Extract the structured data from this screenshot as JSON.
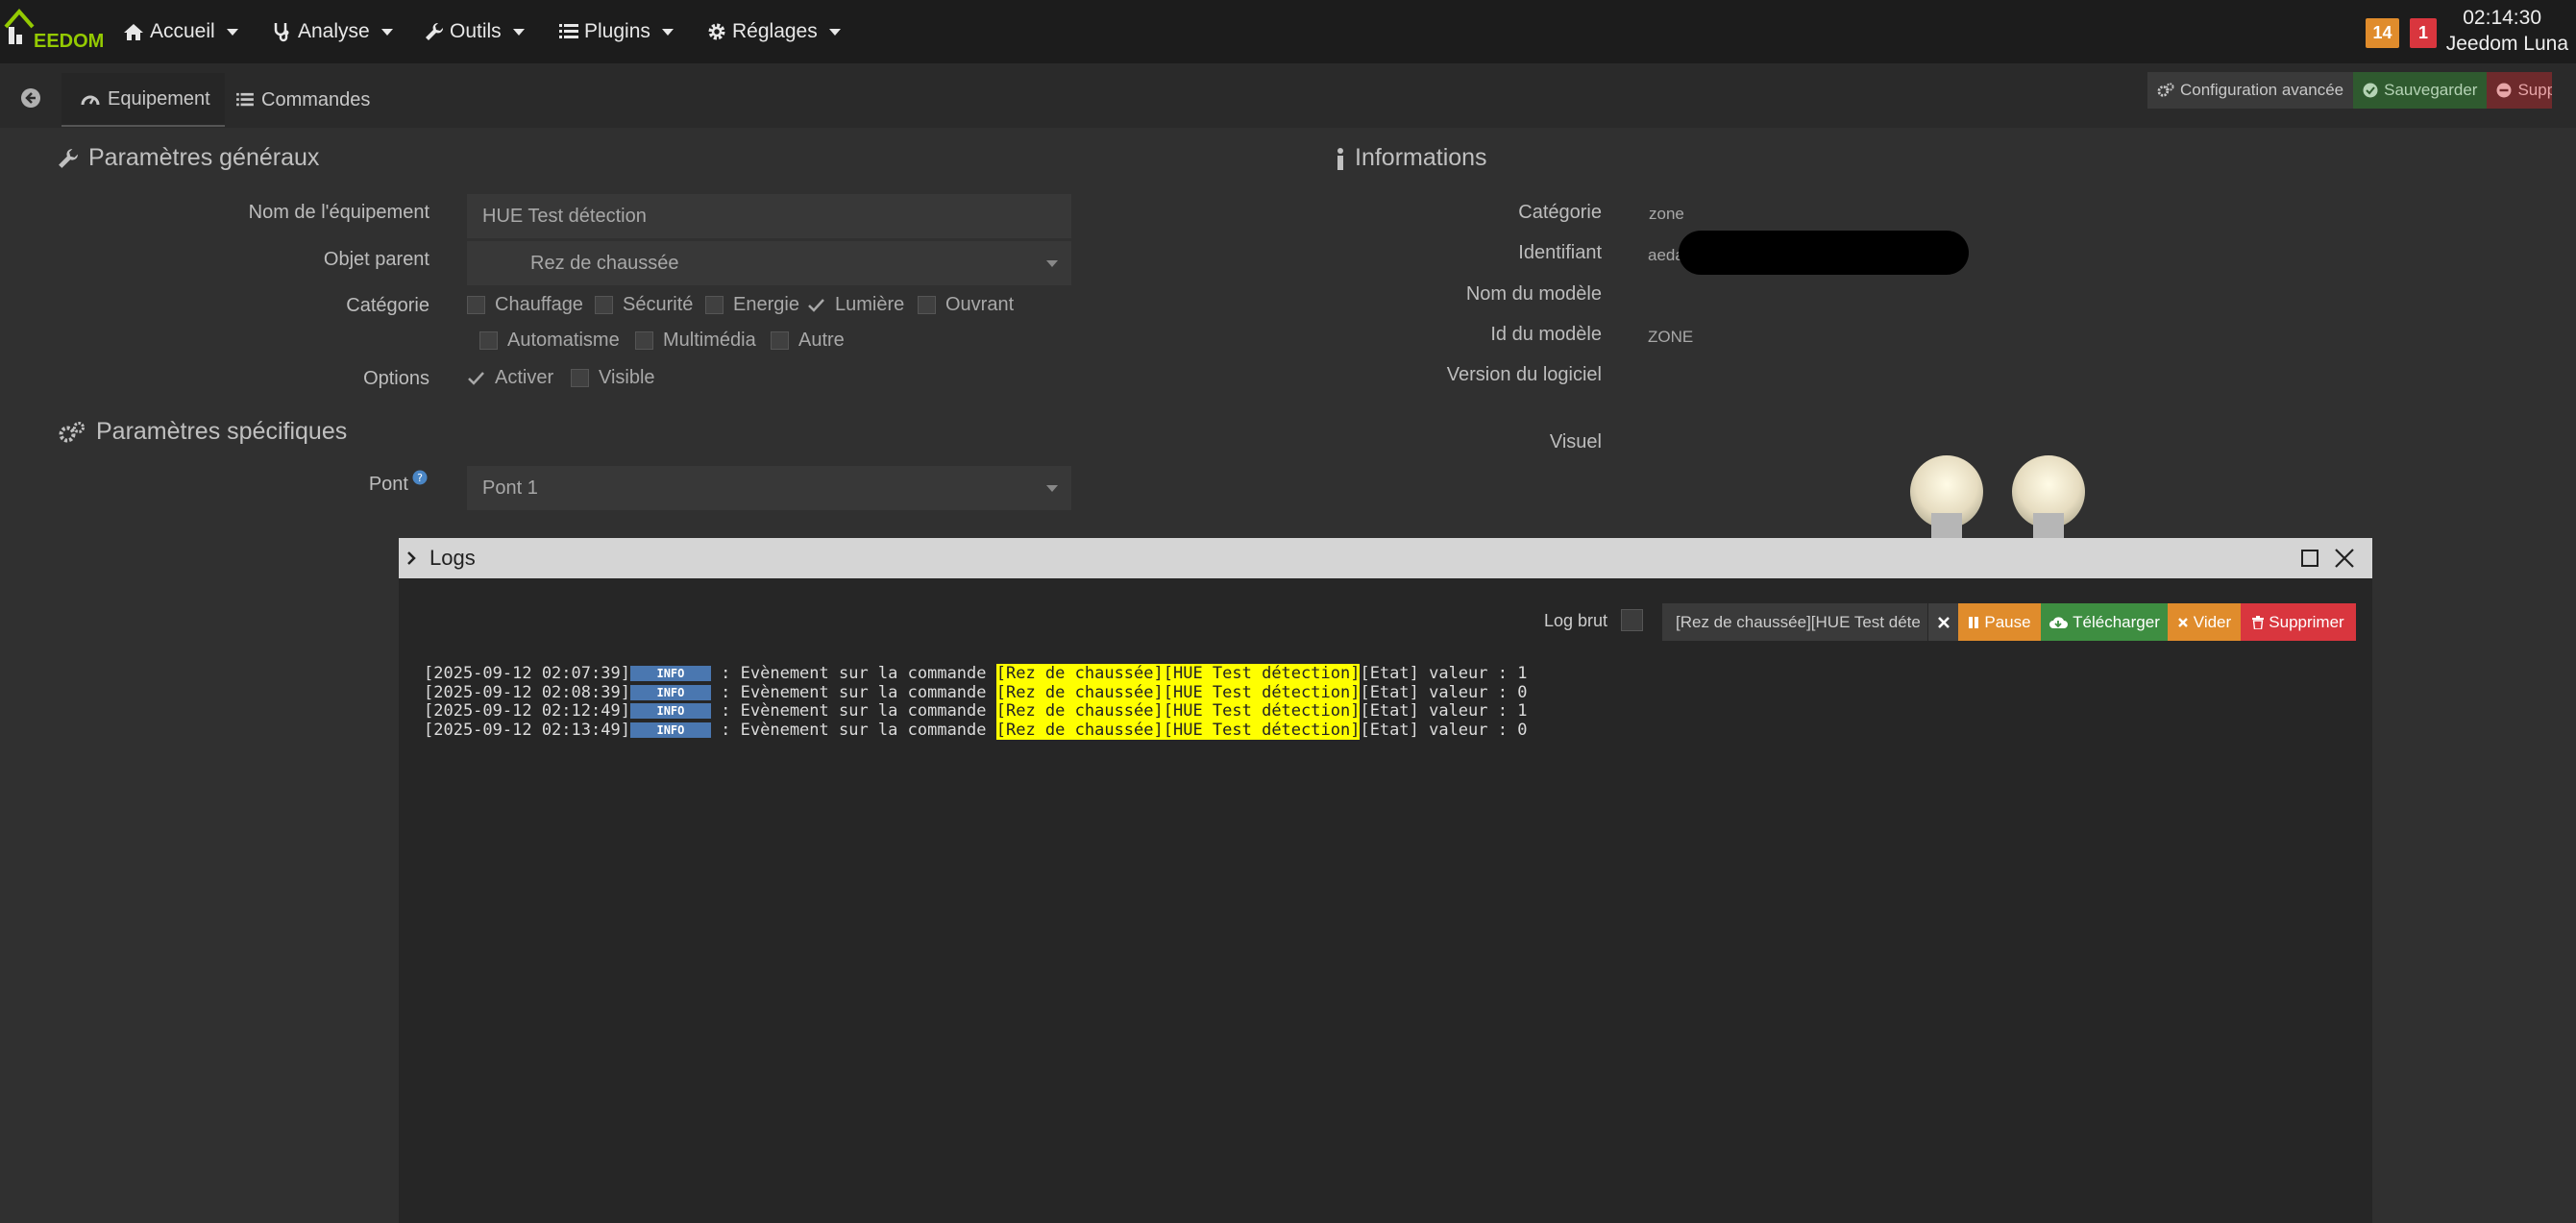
{
  "app": {
    "brand": "EEDOM"
  },
  "nav": [
    {
      "label": "Accueil",
      "icon": "home-icon"
    },
    {
      "label": "Analyse",
      "icon": "stethoscope-icon"
    },
    {
      "label": "Outils",
      "icon": "wrench-icon"
    },
    {
      "label": "Plugins",
      "icon": "list-icon"
    },
    {
      "label": "Réglages",
      "icon": "gear-icon"
    }
  ],
  "header": {
    "badge_warning": "14",
    "badge_danger": "1",
    "time": "02:14:30",
    "user": "Jeedom Luna",
    "colors": {
      "warning": "#e08c2c",
      "danger": "#d9363e",
      "brand": "#94ca02"
    }
  },
  "tabs": [
    {
      "label": "Equipement",
      "icon": "tachometer-icon",
      "active": true
    },
    {
      "label": "Commandes",
      "icon": "list-icon",
      "active": false
    }
  ],
  "actions": {
    "advanced": "Configuration avancée",
    "save": "Sauvegarder",
    "delete": "Supprimer"
  },
  "general": {
    "title": "Paramètres généraux",
    "name_label": "Nom de l'équipement",
    "name_value": "HUE Test détection",
    "parent_label": "Objet parent",
    "parent_value": "Rez de chaussée",
    "category_label": "Catégorie",
    "categories": [
      {
        "label": "Chauffage",
        "checked": false
      },
      {
        "label": "Sécurité",
        "checked": false
      },
      {
        "label": "Energie",
        "checked": false
      },
      {
        "label": "Lumière",
        "checked": true
      },
      {
        "label": "Ouvrant",
        "checked": false
      },
      {
        "label": "Automatisme",
        "checked": false
      },
      {
        "label": "Multimédia",
        "checked": false
      },
      {
        "label": "Autre",
        "checked": false
      }
    ],
    "options_label": "Options",
    "options": [
      {
        "label": "Activer",
        "checked": true
      },
      {
        "label": "Visible",
        "checked": false
      }
    ]
  },
  "specific": {
    "title": "Paramètres spécifiques",
    "bridge_label": "Pont",
    "bridge_value": "Pont 1"
  },
  "info": {
    "title": "Informations",
    "category_label": "Catégorie",
    "category_value": "zone",
    "id_label": "Identifiant",
    "id_value": "aeda",
    "model_name_label": "Nom du modèle",
    "model_id_label": "Id du modèle",
    "model_id_value": "ZONE",
    "software_label": "Version du logiciel",
    "visual_label": "Visuel"
  },
  "modal": {
    "title": "Logs",
    "log_brut_label": "Log brut",
    "search_value": "[Rez de chaussée][HUE Test déte",
    "pause": "Pause",
    "download": "Télécharger",
    "clear": "Vider",
    "delete": "Supprimer",
    "lines": [
      {
        "time": "[2025-09-12 02:07:39]",
        "level": "INFO",
        "text": " : Evènement sur la commande ",
        "highlight": "[Rez de chaussée][HUE Test détection]",
        "tail": "[Etat] valeur : 1"
      },
      {
        "time": "[2025-09-12 02:08:39]",
        "level": "INFO",
        "text": " : Evènement sur la commande ",
        "highlight": "[Rez de chaussée][HUE Test détection]",
        "tail": "[Etat] valeur : 0"
      },
      {
        "time": "[2025-09-12 02:12:49]",
        "level": "INFO",
        "text": " : Evènement sur la commande ",
        "highlight": "[Rez de chaussée][HUE Test détection]",
        "tail": "[Etat] valeur : 1"
      },
      {
        "time": "[2025-09-12 02:13:49]",
        "level": "INFO",
        "text": " : Evènement sur la commande ",
        "highlight": "[Rez de chaussée][HUE Test détection]",
        "tail": "[Etat] valeur : 0"
      }
    ]
  }
}
